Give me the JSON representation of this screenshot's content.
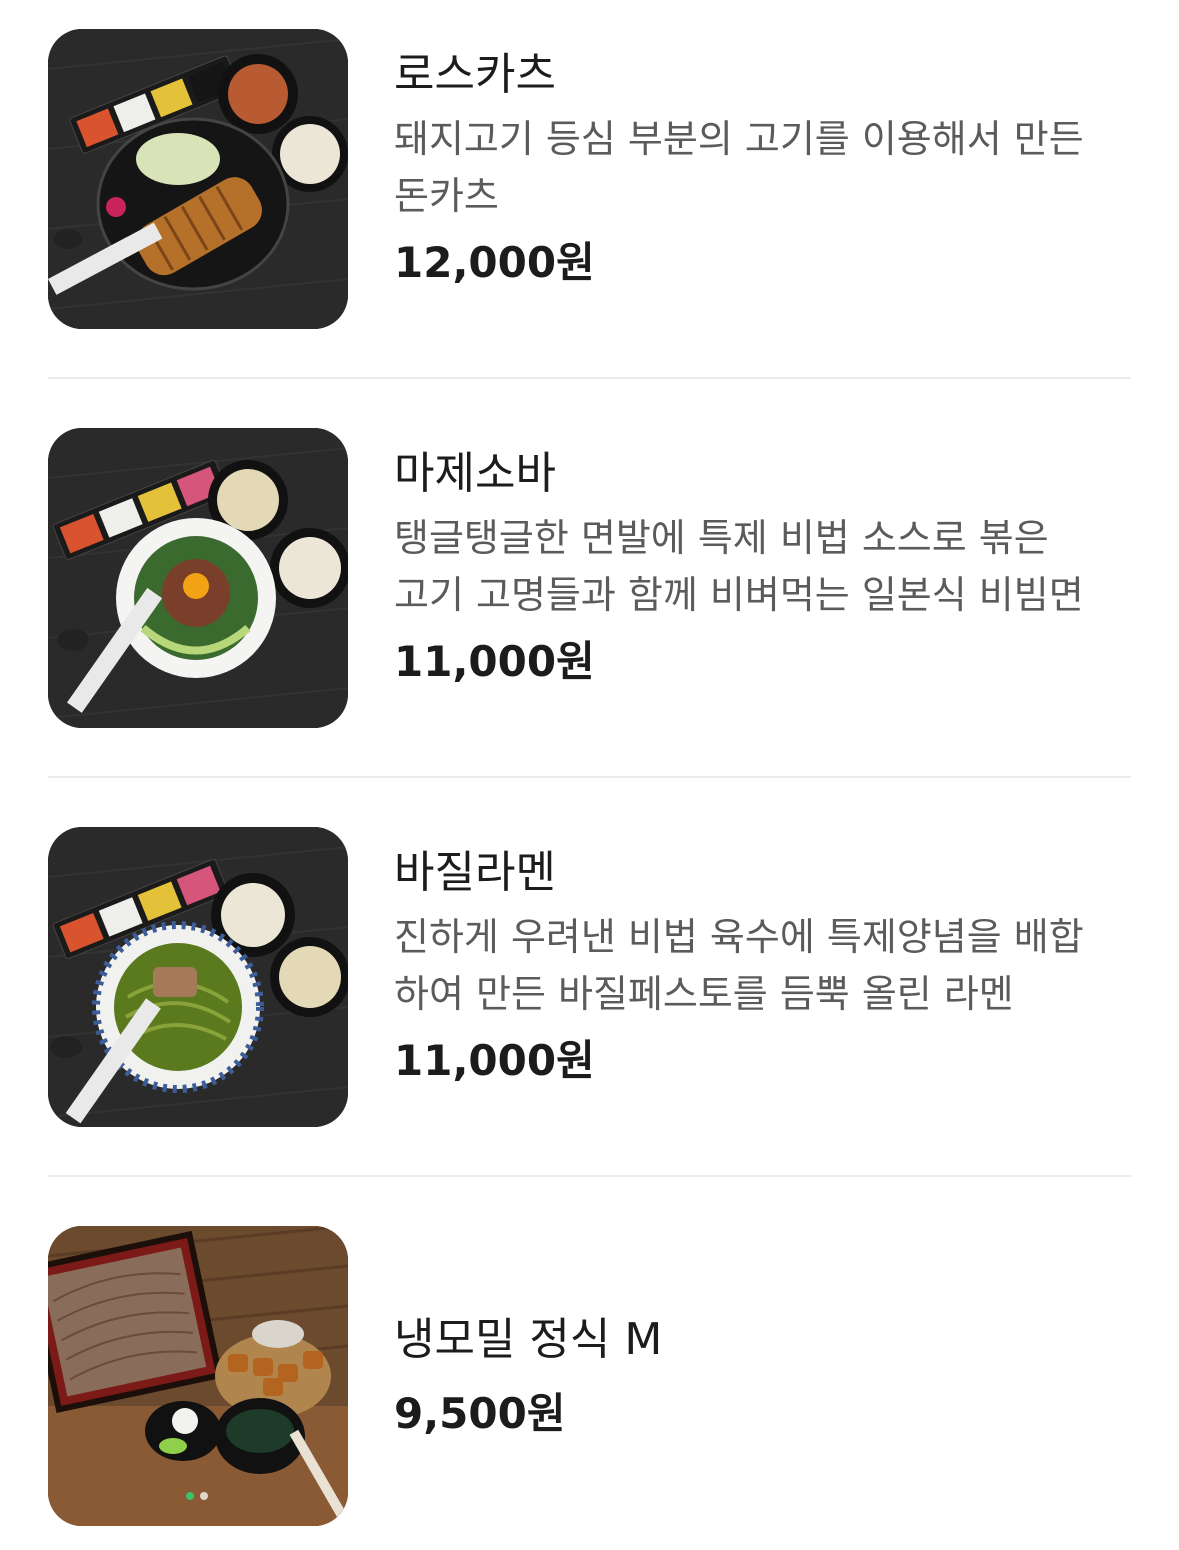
{
  "menu": {
    "items": [
      {
        "name": "로스카츠",
        "description": [
          "돼지고기 등심 부분의 고기를 이용해서 만든",
          "돈카츠"
        ],
        "price": "12,000원",
        "image_icon": "tonkatsu-set-photo"
      },
      {
        "name": "마제소바",
        "description": [
          "탱글탱글한 면발에 특제 비법 소스로 볶은",
          "고기 고명들과 함께 비벼먹는 일본식 비빔면"
        ],
        "price": "11,000원",
        "image_icon": "mazesoba-set-photo"
      },
      {
        "name": "바질라멘",
        "description": [
          "진하게 우려낸 비법 육수에 특제양념을 배합",
          "하여 만든 바질페스토를 듬뿍 올린 라멘"
        ],
        "price": "11,000원",
        "image_icon": "basil-ramen-set-photo"
      },
      {
        "name": "냉모밀 정식 M",
        "description": [],
        "price": "9,500원",
        "image_icon": "cold-soba-set-photo"
      }
    ],
    "carousel": {
      "pages": 2,
      "active_index": 0,
      "active_color": "#3ac36b"
    }
  },
  "colors": {
    "title": "#1c1c1e",
    "description": "#5b5b5e",
    "divider": "#ececef",
    "photo_background_dark": "#2b2b2b",
    "photo_background_wood": "#6b4a2e"
  }
}
